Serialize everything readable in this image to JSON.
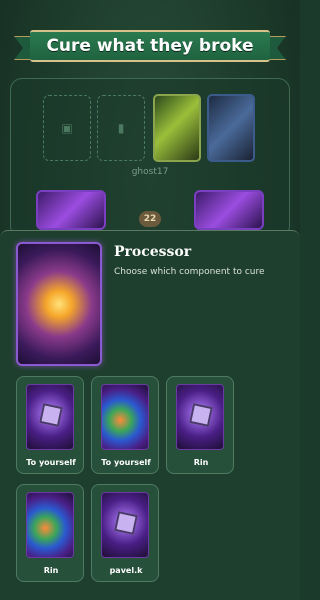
{
  "header": {
    "title": "Cure what they broke"
  },
  "board": {
    "owner_name": "ghost17",
    "counter": "22",
    "empty_slots": [
      "cpu-slot-icon",
      "power-slot-icon"
    ],
    "cards": [
      "motherboard",
      "armor"
    ]
  },
  "featured": {
    "title": "Processor",
    "description": "Choose which component to cure"
  },
  "options": [
    {
      "label": "To yourself",
      "art": "processor-card"
    },
    {
      "label": "To yourself",
      "art": "mixed-card"
    },
    {
      "label": "Rin",
      "art": "processor-card"
    },
    {
      "label": "Rin",
      "art": "mixed-card"
    },
    {
      "label": "pavel.k",
      "art": "processor-card"
    }
  ],
  "colors": {
    "background": "#1c3a2c",
    "ribbon": "#2b7a4f",
    "gold": "#d7c38a",
    "purple_card": "#8a5ad0"
  }
}
